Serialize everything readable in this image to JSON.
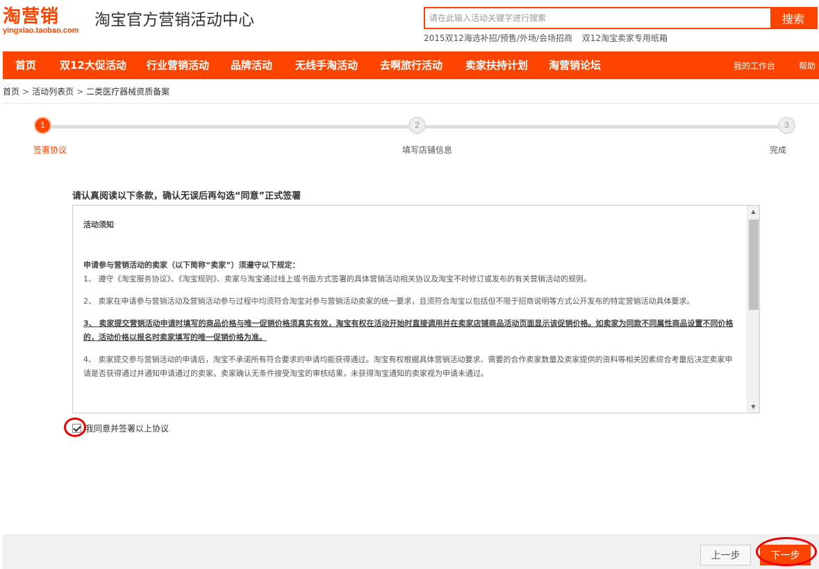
{
  "header": {
    "logo_text": "淘营销",
    "logo_domain": "yingxiao.taobao.com",
    "site_title": "淘宝官方营销活动中心",
    "search_placeholder": "请在此输入活动关键字进行搜索",
    "search_button": "搜索",
    "hot_links": [
      "2015双12海选补招/预售/外场/会场招商",
      "双12淘宝卖家专用纸箱"
    ]
  },
  "nav": {
    "items": [
      "首页",
      "双12大促活动",
      "行业营销活动",
      "品牌活动",
      "无线手淘活动",
      "去啊旅行活动",
      "卖家扶持计划",
      "淘营销论坛"
    ],
    "right": [
      "我的工作台",
      "帮助"
    ]
  },
  "breadcrumb": [
    "首页",
    "活动列表页",
    "二类医疗器械资质备案"
  ],
  "steps": [
    {
      "number": "1",
      "label": "签署协议",
      "active": true
    },
    {
      "number": "2",
      "label": "填写店铺信息",
      "active": false
    },
    {
      "number": "3",
      "label": "完成",
      "active": false
    }
  ],
  "agreement": {
    "heading": "请认真阅读以下条款，确认无误后再勾选“同意”正式签署",
    "title": "活动须知",
    "intro": "申请参与营销活动的卖家（以下简称“卖家”）须遵守以下规定：",
    "clause1": "1、 遵守《淘宝服务协议》、《淘宝规则》、卖家与淘宝通过线上或书面方式签署的具体营销活动相关协议及淘宝不时修订或发布的有关营销活动的规则。",
    "clause2": "2、 卖家在申请参与营销活动及营销活动参与过程中均须符合淘宝对参与营销活动卖家的统一要求，且须符合淘宝以包括但不限于招商说明等方式公开发布的特定营销活动具体要求。",
    "clause3": "3、 卖家提交营销活动申请时填写的商品价格与唯一促销价格须真实有效，淘宝有权在活动开始时直接调用并在卖家店铺商品活动页面显示该促销价格。如卖家为同款不同属性商品设置不同价格的，活动价格以报名时卖家填写的唯一促销价格为准。",
    "clause4": "4、 卖家提交参与营销活动的申请后，淘宝不承诺所有符合要求的申请均能获得通过。淘宝有权根据具体营销活动要求、需要的合作卖家数量及卖家提供的资料等相关因素综合考量后决定卖家申请是否获得通过并通知申请通过的卖家。卖家确认无条件接受淘宝的审核结果，未获得淘宝通知的卖家视为申请未通过。",
    "checkbox_label": "我同意并签署以上协议",
    "checked": true
  },
  "footer": {
    "prev_button": "上一步",
    "next_button": "下一步"
  },
  "colors": {
    "brand": "#ff4400",
    "annotation": "#ee0000"
  }
}
